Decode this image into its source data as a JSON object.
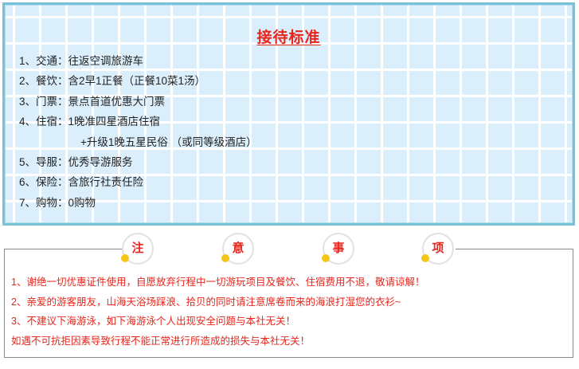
{
  "standard": {
    "title": "接待标准",
    "items": [
      "1、交通：往返空调旅游车",
      "2、餐饮：含2早1正餐（正餐10菜1汤）",
      "3、门票：景点首道优惠大门票",
      "4、住宿：1晚准四星酒店住宿",
      "+升级1晚五星民俗 （或同等级酒店）",
      "5、导服：优秀导游服务",
      "6、保险：含旅行社责任险",
      "7、购物：0购物"
    ]
  },
  "notice": {
    "badges": [
      "注",
      "意",
      "事",
      "项"
    ],
    "items": [
      "1、谢绝一切优惠证件使用，自愿放弃行程中一切游玩项目及餐饮、住宿费用不退，敬请谅解！",
      "2、亲爱的游客朋友，山海天浴场踩浪、拾贝的同时请注意席卷而来的海浪打湿您的衣衫~",
      "3、不建议下海游泳，如下海游泳个人出现安全问题与本社无关！",
      "如遇不可抗拒因素导致行程不能正常进行所造成的损失与本社无关！"
    ]
  },
  "colors": {
    "accent": "#e6261c",
    "panel": "#dbeefc",
    "border": "#76c2d6",
    "dot": "#f5c518"
  }
}
